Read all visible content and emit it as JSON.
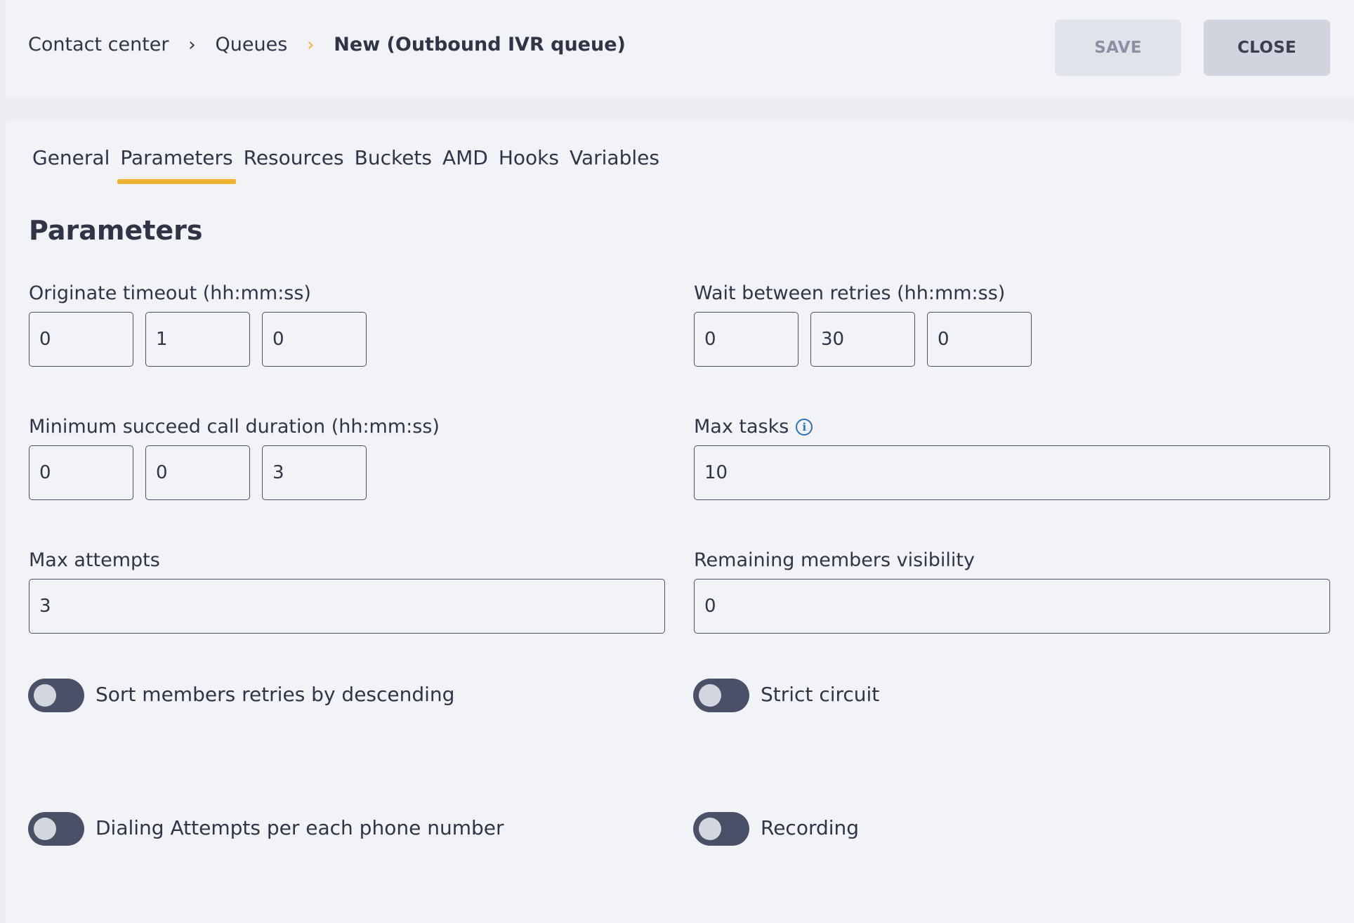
{
  "breadcrumb": {
    "items": [
      "Contact center",
      "Queues"
    ],
    "current": "New (Outbound IVR queue)",
    "separator": "›"
  },
  "actions": {
    "save_label": "SAVE",
    "close_label": "CLOSE"
  },
  "tabs": [
    {
      "label": "General",
      "active": false
    },
    {
      "label": "Parameters",
      "active": true
    },
    {
      "label": "Resources",
      "active": false
    },
    {
      "label": "Buckets",
      "active": false
    },
    {
      "label": "AMD",
      "active": false
    },
    {
      "label": "Hooks",
      "active": false
    },
    {
      "label": "Variables",
      "active": false
    }
  ],
  "section": {
    "title": "Parameters"
  },
  "fields": {
    "originate_timeout": {
      "label": "Originate timeout (hh:mm:ss)",
      "hours": "0",
      "minutes": "1",
      "seconds": "0"
    },
    "wait_between_retries": {
      "label": "Wait between retries (hh:mm:ss)",
      "hours": "0",
      "minutes": "30",
      "seconds": "0"
    },
    "min_call_duration": {
      "label": "Minimum succeed call duration (hh:mm:ss)",
      "hours": "0",
      "minutes": "0",
      "seconds": "3"
    },
    "max_tasks": {
      "label": "Max tasks",
      "value": "10",
      "info_icon": "info-icon"
    },
    "max_attempts": {
      "label": "Max attempts",
      "value": "3"
    },
    "remaining_members_visibility": {
      "label": "Remaining members visibility",
      "value": "0"
    }
  },
  "toggles": {
    "sort_retries_desc": {
      "label": "Sort members retries by descending",
      "on": false
    },
    "strict_circuit": {
      "label": "Strict circuit",
      "on": false
    },
    "dialing_attempts_per_number": {
      "label": "Dialing Attempts per each phone number",
      "on": false
    },
    "recording": {
      "label": "Recording",
      "on": false
    }
  },
  "colors": {
    "accent": "#f0b232",
    "info": "#2e6fc1",
    "toggle_off": "#4a5068"
  }
}
